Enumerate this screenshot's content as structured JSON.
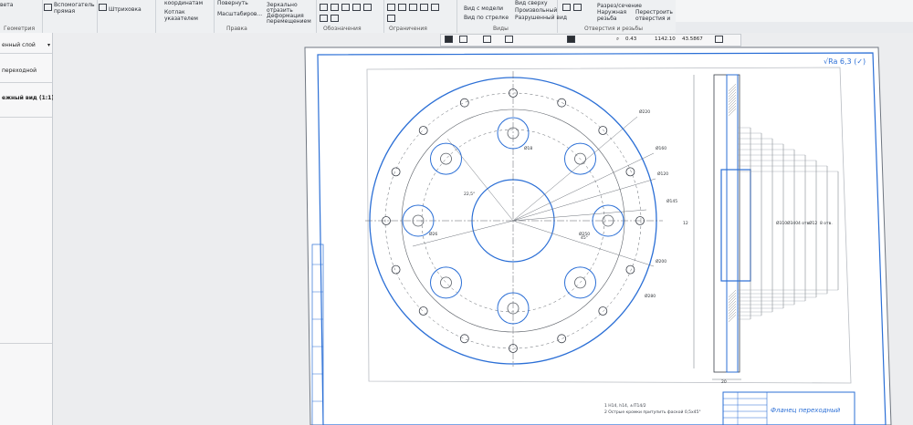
{
  "ribbon": {
    "items": [
      "вета",
      "Вспомогатель",
      "прямая",
      "Штриховка",
      "координатам",
      "Котлак",
      "указателем",
      "Повернуть",
      "Масштабиров...",
      "Зеркально",
      "отразить",
      "Деформация",
      "перемещением",
      "Вид с модели",
      "Вид по стрелке",
      "Разрушенный вид",
      "Вид сверху",
      "Произвольный",
      "Разрез/сечение",
      "Наружная",
      "резьба",
      "Перестроить",
      "отверстия и"
    ],
    "groups": [
      "Геометрия",
      "Правка",
      "Обозначения",
      "Ограничения",
      "Виды",
      "Отверстия и резьбы"
    ]
  },
  "panel": {
    "rows": [
      "енный слой",
      "переходной",
      "ежный вид (1:1)"
    ]
  },
  "toolbar": {
    "zoom": "0.43",
    "coord_x": "1142.10",
    "coord_y": "43.5867"
  },
  "drawing": {
    "title": "Фланец переходный",
    "roughness": "√Ra 6,3 (✓)",
    "notes": [
      "1 Н14, h14, ±IT14/2",
      "2 Острые кромки притупить фаской 0,5х45°"
    ],
    "dims": [
      "Ø220",
      "Ø160",
      "Ø120",
      "Ø145",
      "Ø200",
      "Ø250",
      "Ø280",
      "Ø310",
      "Ø340",
      "4 отв.",
      "Ø12",
      "8 отв.",
      "Ø18",
      "Ø26",
      "22,5°",
      "45°",
      "12",
      "20"
    ]
  },
  "colors": {
    "accent": "#2b6fd6",
    "line": "#5a5f66"
  }
}
